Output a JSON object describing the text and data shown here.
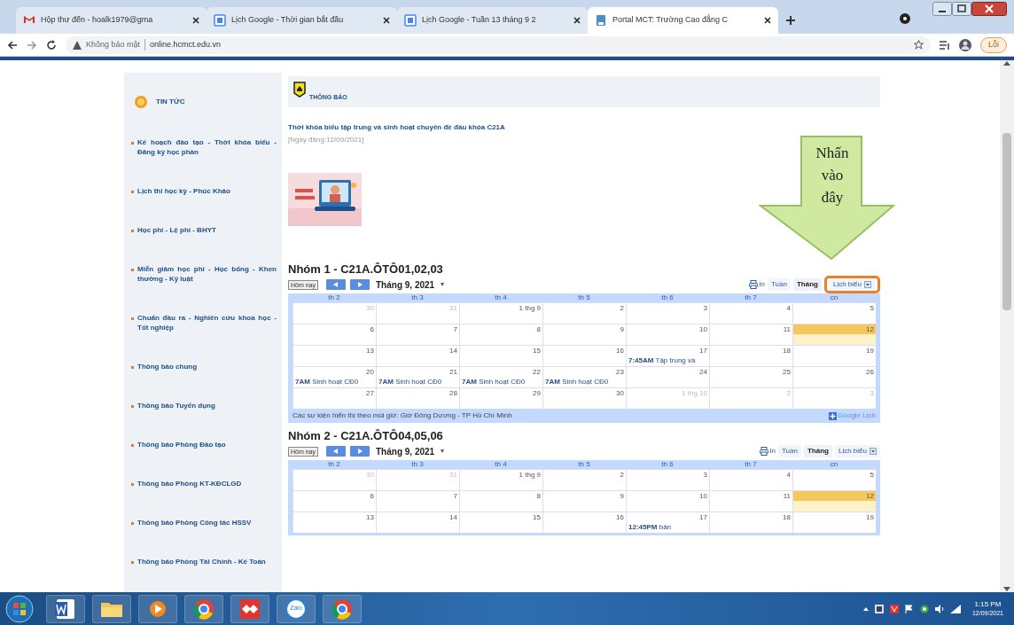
{
  "browser": {
    "tabs": [
      {
        "kind": "mail",
        "title": "Hộp thư đến - hoalk1979@gma",
        "selected": false
      },
      {
        "kind": "calendar",
        "title": "Lịch Google - Thời gian bắt đầu",
        "selected": false
      },
      {
        "kind": "calendar",
        "title": "Lịch Google - Tuần 13 tháng 9 2",
        "selected": false
      },
      {
        "kind": "portal",
        "title": "Portal MCT: Trường Cao đẳng C",
        "selected": true
      }
    ],
    "security": "Không bảo mật",
    "url": "online.hcmct.edu.vn",
    "profile": "Lỗi"
  },
  "sidebar": {
    "title": "TIN TỨC",
    "items": [
      "Kế hoạch đào tạo - Thời khóa biểu - Đăng ký học phần",
      "Lịch thi học kỳ - Phúc Khảo",
      "Học phí - Lệ phí - BHYT",
      "Miễn giảm học phí - Học bổng - Khen thưởng - Kỷ luật",
      "Chuẩn đầu ra - Nghiên cứu khoa học - Tốt nghiệp",
      "Thông báo chung",
      "Thông báo Tuyển dụng",
      "Thông báo Phòng Đào tạo",
      "Thông báo Phòng KT-KĐCLGD",
      "Thông báo Phòng Công tác HSSV",
      "Thông báo Phòng Tài Chính - Kế Toán"
    ]
  },
  "notice": {
    "title": "THÔNG BÁO",
    "post_title": "Thời khóa biểu tập trung và sinh hoạt chuyên đề đầu khóa C21A",
    "post_date": "[Ngày đăng:12/09/2021]"
  },
  "callout": {
    "text": "Nhấn vào đây"
  },
  "calendars": [
    {
      "title": "Nhóm 1 - C21A.ÔTÔ01,02,03",
      "today_button": "Hôm nay",
      "month": "Tháng 9, 2021",
      "month_caret": "▾",
      "print": "In",
      "views": [
        {
          "label": "Tuần",
          "selected": false,
          "outlined": false
        },
        {
          "label": "Tháng",
          "selected": true,
          "outlined": false
        },
        {
          "label": "Lịch biểu",
          "selected": false,
          "outlined": true
        }
      ],
      "day_headers": [
        "th 2",
        "th 3",
        "th 4",
        "th 5",
        "th 6",
        "th 7",
        "cn"
      ],
      "weeks": [
        [
          {
            "date": "30",
            "muted": true,
            "today": false
          },
          {
            "date": "31",
            "muted": true,
            "today": false
          },
          {
            "date": "1 thg 9",
            "muted": false,
            "today": false
          },
          {
            "date": "2",
            "muted": false,
            "today": false
          },
          {
            "date": "3",
            "muted": false,
            "today": false
          },
          {
            "date": "4",
            "muted": false,
            "today": false
          },
          {
            "date": "5",
            "muted": false,
            "today": false
          }
        ],
        [
          {
            "date": "6",
            "muted": false,
            "today": false
          },
          {
            "date": "7",
            "muted": false,
            "today": false
          },
          {
            "date": "8",
            "muted": false,
            "today": false
          },
          {
            "date": "9",
            "muted": false,
            "today": false
          },
          {
            "date": "10",
            "muted": false,
            "today": false
          },
          {
            "date": "11",
            "muted": false,
            "today": false
          },
          {
            "date": "12",
            "muted": false,
            "today": true
          }
        ],
        [
          {
            "date": "13",
            "muted": false,
            "today": false
          },
          {
            "date": "14",
            "muted": false,
            "today": false
          },
          {
            "date": "15",
            "muted": false,
            "today": false
          },
          {
            "date": "16",
            "muted": false,
            "today": false
          },
          {
            "date": "17",
            "muted": false,
            "today": false,
            "event": {
              "time": "7:45AM",
              "text": "Tập trung và"
            }
          },
          {
            "date": "18",
            "muted": false,
            "today": false
          },
          {
            "date": "19",
            "muted": false,
            "today": false
          }
        ],
        [
          {
            "date": "20",
            "muted": false,
            "today": false,
            "event": {
              "time": "7AM",
              "text": "Sinh hoạt CĐ0"
            }
          },
          {
            "date": "21",
            "muted": false,
            "today": false,
            "event": {
              "time": "7AM",
              "text": "Sinh hoạt CĐ0"
            }
          },
          {
            "date": "22",
            "muted": false,
            "today": false,
            "event": {
              "time": "7AM",
              "text": "Sinh hoạt CĐ0"
            }
          },
          {
            "date": "23",
            "muted": false,
            "today": false,
            "event": {
              "time": "7AM",
              "text": "Sinh hoạt CĐ0"
            }
          },
          {
            "date": "24",
            "muted": false,
            "today": false
          },
          {
            "date": "25",
            "muted": false,
            "today": false
          },
          {
            "date": "26",
            "muted": false,
            "today": false
          }
        ],
        [
          {
            "date": "27",
            "muted": false,
            "today": false
          },
          {
            "date": "28",
            "muted": false,
            "today": false
          },
          {
            "date": "29",
            "muted": false,
            "today": false
          },
          {
            "date": "30",
            "muted": false,
            "today": false
          },
          {
            "date": "1 thg 10",
            "muted": true,
            "today": false
          },
          {
            "date": "2",
            "muted": true,
            "today": false
          },
          {
            "date": "3",
            "muted": true,
            "today": false
          }
        ]
      ],
      "footer": "Các sự kiện hiển thị theo múi giờ: Giờ Đông Dương - TP Hồ Chí Minh",
      "google_button": "Google Lịch"
    },
    {
      "title": "Nhóm 2 - C21A.ÔTÔ04,05,06",
      "today_button": "Hôm nay",
      "month": "Tháng 9, 2021",
      "month_caret": "▾",
      "print": "In",
      "views": [
        {
          "label": "Tuần",
          "selected": false,
          "outlined": false
        },
        {
          "label": "Tháng",
          "selected": true,
          "outlined": false
        },
        {
          "label": "Lịch biểu",
          "selected": false,
          "outlined": false
        }
      ],
      "day_headers": [
        "th 2",
        "th 3",
        "th 4",
        "th 5",
        "th 6",
        "th 7",
        "cn"
      ],
      "weeks": [
        [
          {
            "date": "30",
            "muted": true,
            "today": false
          },
          {
            "date": "31",
            "muted": true,
            "today": false
          },
          {
            "date": "1 thg 9",
            "muted": false,
            "today": false
          },
          {
            "date": "2",
            "muted": false,
            "today": false
          },
          {
            "date": "3",
            "muted": false,
            "today": false
          },
          {
            "date": "4",
            "muted": false,
            "today": false
          },
          {
            "date": "5",
            "muted": false,
            "today": false
          }
        ],
        [
          {
            "date": "6",
            "muted": false,
            "today": false
          },
          {
            "date": "7",
            "muted": false,
            "today": false
          },
          {
            "date": "8",
            "muted": false,
            "today": false
          },
          {
            "date": "9",
            "muted": false,
            "today": false
          },
          {
            "date": "10",
            "muted": false,
            "today": false
          },
          {
            "date": "11",
            "muted": false,
            "today": false
          },
          {
            "date": "12",
            "muted": false,
            "today": true
          }
        ],
        [
          {
            "date": "13",
            "muted": false,
            "today": false
          },
          {
            "date": "14",
            "muted": false,
            "today": false
          },
          {
            "date": "15",
            "muted": false,
            "today": false
          },
          {
            "date": "16",
            "muted": false,
            "today": false
          },
          {
            "date": "17",
            "muted": false,
            "today": false,
            "event": {
              "time": "12:45PM",
              "text": "bản"
            }
          },
          {
            "date": "18",
            "muted": false,
            "today": false
          },
          {
            "date": "19",
            "muted": false,
            "today": false
          }
        ]
      ]
    }
  ],
  "taskbar": {
    "apps": [
      {
        "kind": "word"
      },
      {
        "kind": "folder"
      },
      {
        "kind": "media"
      },
      {
        "kind": "chrome"
      },
      {
        "kind": "anydesk"
      },
      {
        "kind": "zalo",
        "label": "Zalo"
      },
      {
        "kind": "chrome"
      }
    ],
    "time": "1:15 PM",
    "date": "12/09/2021"
  }
}
